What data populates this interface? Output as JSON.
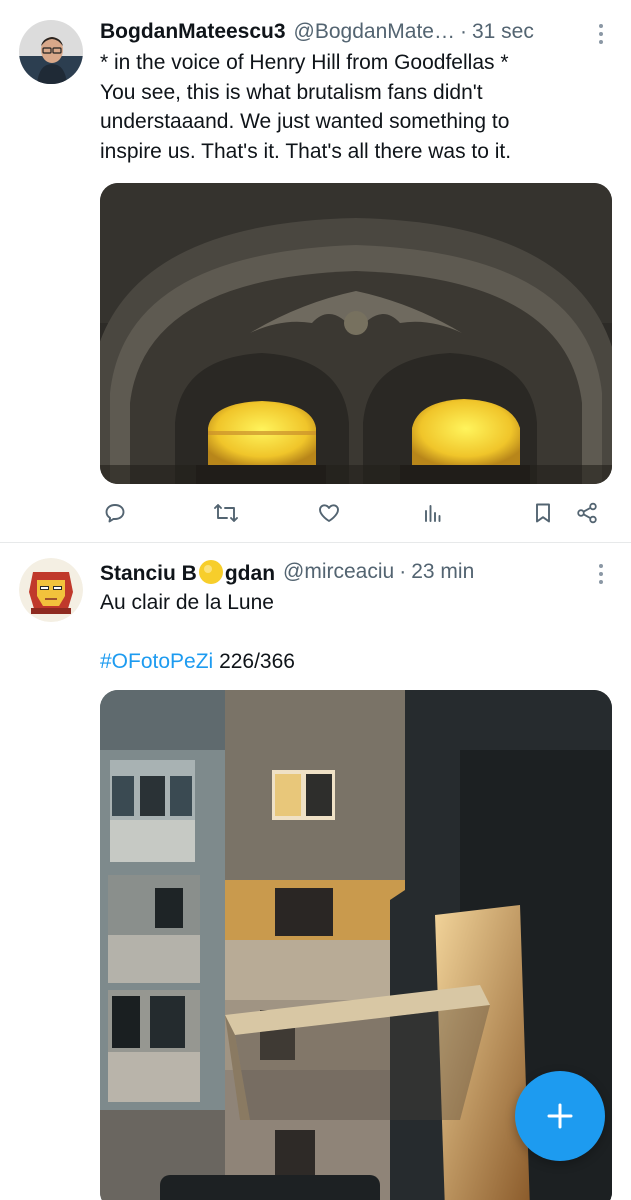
{
  "tweets": [
    {
      "name": "BogdanMateescu3",
      "handle": "@BogdanMate…",
      "separator": "·",
      "time": "31 sec",
      "lines": [
        "* in the voice of Henry Hill from Goodfellas *",
        "You see, this is what brutalism fans didn't",
        "understaaand. We just wanted something to",
        "inspire us. That's it. That's all there was to it."
      ],
      "avatar_icon": "person-photo-avatar",
      "media_icon": "arched-windows-photo"
    },
    {
      "name_before": "Stanciu B",
      "name_after": "gdan",
      "emoji_icon": "yellow-circle-emoji",
      "handle": "@mirceaciu",
      "separator": "·",
      "time": "23 min",
      "text": "Au clair de la Lune",
      "hashtag": "#OFotoPeZi",
      "counter": "226/366",
      "avatar_icon": "iron-man-avatar",
      "media_icon": "apartment-block-night-photo"
    }
  ],
  "actions": [
    "reply-icon",
    "retweet-icon",
    "like-icon",
    "analytics-icon",
    "bookmark-icon",
    "share-icon"
  ],
  "fab": {
    "icon": "compose-plus-icon"
  },
  "colors": {
    "accent": "#1d9bf0",
    "text": "#0f1419",
    "secondary": "#536471",
    "divider": "#e7e9ea"
  }
}
